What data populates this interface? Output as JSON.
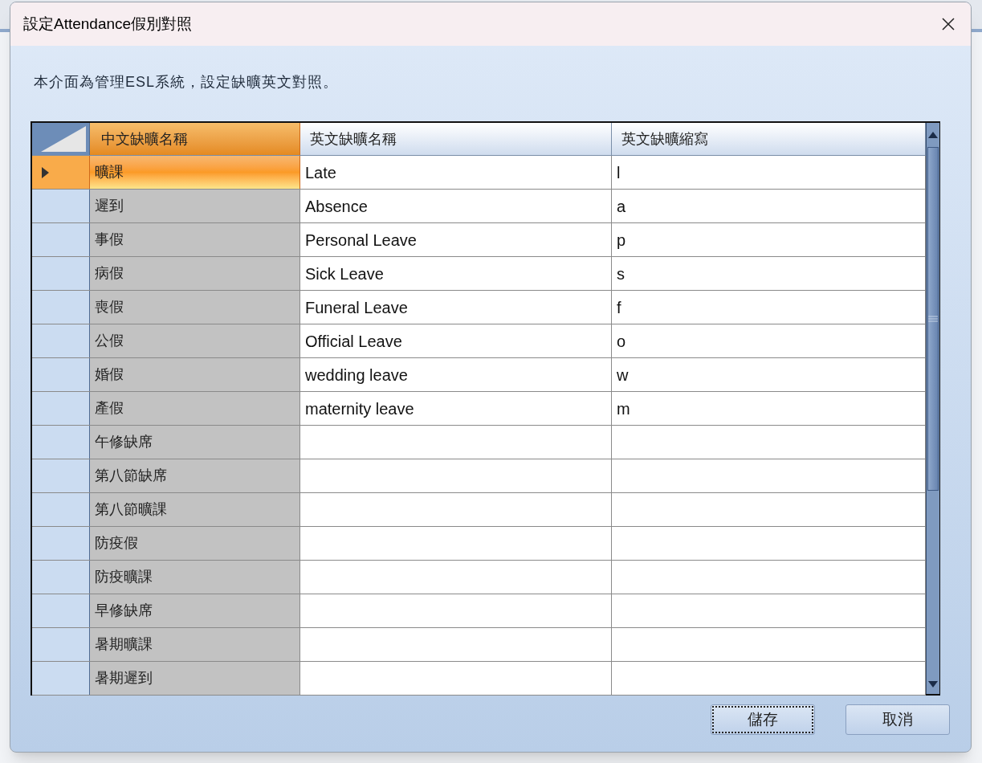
{
  "window": {
    "title": "設定Attendance假別對照"
  },
  "description": "本介面為管理ESL系統，設定缺曠英文對照。",
  "table": {
    "columns": [
      "中文缺曠名稱",
      "英文缺曠名稱",
      "英文缺曠縮寫"
    ],
    "rows": [
      {
        "selected": true,
        "chinese": "曠課",
        "english": "Late",
        "abbreviation": "l"
      },
      {
        "selected": false,
        "chinese": "遲到",
        "english": "Absence",
        "abbreviation": "a"
      },
      {
        "selected": false,
        "chinese": "事假",
        "english": "Personal Leave",
        "abbreviation": "p"
      },
      {
        "selected": false,
        "chinese": "病假",
        "english": "Sick Leave",
        "abbreviation": "s"
      },
      {
        "selected": false,
        "chinese": "喪假",
        "english": "Funeral Leave",
        "abbreviation": "f"
      },
      {
        "selected": false,
        "chinese": "公假",
        "english": "Official Leave",
        "abbreviation": "o"
      },
      {
        "selected": false,
        "chinese": "婚假",
        "english": "wedding leave",
        "abbreviation": "w"
      },
      {
        "selected": false,
        "chinese": "產假",
        "english": "maternity leave",
        "abbreviation": "m"
      },
      {
        "selected": false,
        "chinese": "午修缺席"
      },
      {
        "selected": false,
        "chinese": "第八節缺席"
      },
      {
        "selected": false,
        "chinese": "第八節曠課"
      },
      {
        "selected": false,
        "chinese": "防疫假"
      },
      {
        "selected": false,
        "chinese": "防疫曠課"
      },
      {
        "selected": false,
        "chinese": "早修缺席"
      },
      {
        "selected": false,
        "chinese": "暑期曠課"
      },
      {
        "selected": false,
        "chinese": "暑期遲到"
      }
    ]
  },
  "buttons": [
    {
      "label": "儲存",
      "focused": true
    },
    {
      "label": "取消",
      "focused": false
    }
  ]
}
